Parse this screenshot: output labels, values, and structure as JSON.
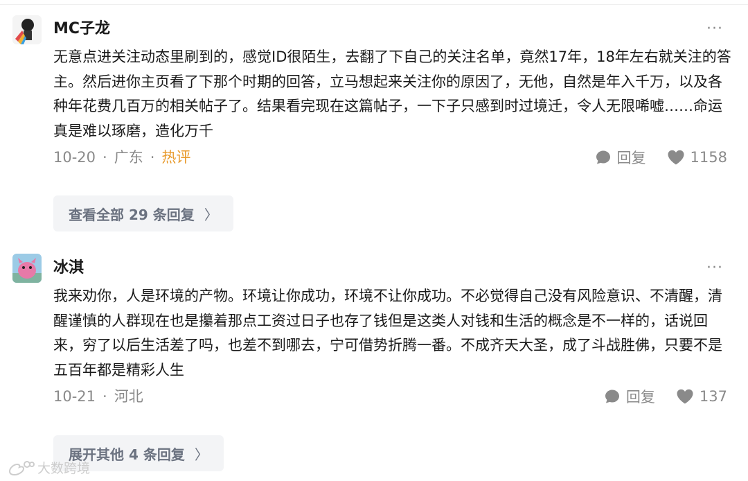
{
  "comments": [
    {
      "user": "MC子龙",
      "content": "无意点进关注动态里刷到的，感觉ID很陌生，去翻了下自己的关注名单，竟然17年，18年左右就关注的答主。然后进你主页看了下那个时期的回答，立马想起来关注你的原因了，无他，自然是年入千万，以及各种年花费几百万的相关帖子了。结果看完现在这篇帖子，一下子只感到时过境迁，令人无限唏嘘……命运真是难以琢磨，造化万千",
      "date": "10-20",
      "location": "广东",
      "badge": "热评",
      "reply_label": "回复",
      "likes": "1158",
      "replies_button": "查看全部 29 条回复",
      "chevron": "〉"
    },
    {
      "user": "冰淇",
      "content": "我来劝你，人是环境的产物。环境让你成功，环境不让你成功。不必觉得自己没有风险意识、不清醒，清醒谨慎的人群现在也是攥着那点工资过日子也存了钱但是这类人对钱和生活的概念是不一样的，话说回来，穷了以后生活差了吗，也差不到哪去，宁可借势折腾一番。不成齐天大圣，成了斗战胜佛，只要不是五百年都是精彩人生",
      "date": "10-21",
      "location": "河北",
      "reply_label": "回复",
      "likes": "137",
      "replies_button": "展开其他 4 条回复",
      "chevron": "〉"
    }
  ],
  "more_glyph": "···",
  "separator": "·",
  "watermark": "大数跨境",
  "colors": {
    "hot": "#e89a2c",
    "meta": "#8a8a8a",
    "button_bg": "#f3f4f6"
  },
  "icons": {
    "more": "more-horizontal-icon",
    "reply": "comment-bubble-icon",
    "like": "heart-icon"
  }
}
